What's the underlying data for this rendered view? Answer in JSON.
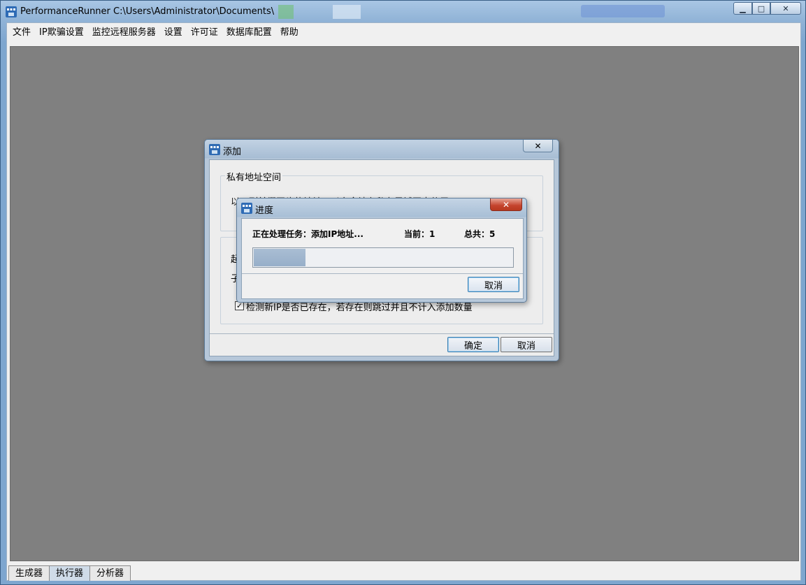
{
  "window": {
    "title": "PerformanceRunner  C:\\Users\\Administrator\\Documents\\",
    "minimize_glyph": "▁",
    "maximize_glyph": "□",
    "close_glyph": "✕"
  },
  "menubar": {
    "items": [
      "文件",
      "IP欺骗设置",
      "监控远程服务器",
      "设置",
      "许可证",
      "数据库配置",
      "帮助"
    ]
  },
  "tabs": [
    {
      "label": "生成器",
      "active": false
    },
    {
      "label": "执行器",
      "active": true
    },
    {
      "label": "分析器",
      "active": false
    }
  ],
  "add_dialog": {
    "title": "添加",
    "close_glyph": "✕",
    "group1_title": "私有地址空间",
    "group1_text": "以下列前缀开头的地址可以安全地在私有局域网中使用",
    "group2_title": "起",
    "group2_text": "子",
    "checkbox_label": "检测新IP是否已存在，若存在则跳过并且不计入添加数量",
    "checkbox_checked": true,
    "checkbox_glyph": "✓",
    "ok_label": "确定",
    "cancel_label": "取消"
  },
  "progress_dialog": {
    "title": "进度",
    "close_glyph": "✕",
    "task_label": "正在处理任务：添加IP地址...",
    "current_label": "当前：1",
    "total_label": "总共：5",
    "progress_fraction": 0.2,
    "cancel_label": "取消"
  }
}
